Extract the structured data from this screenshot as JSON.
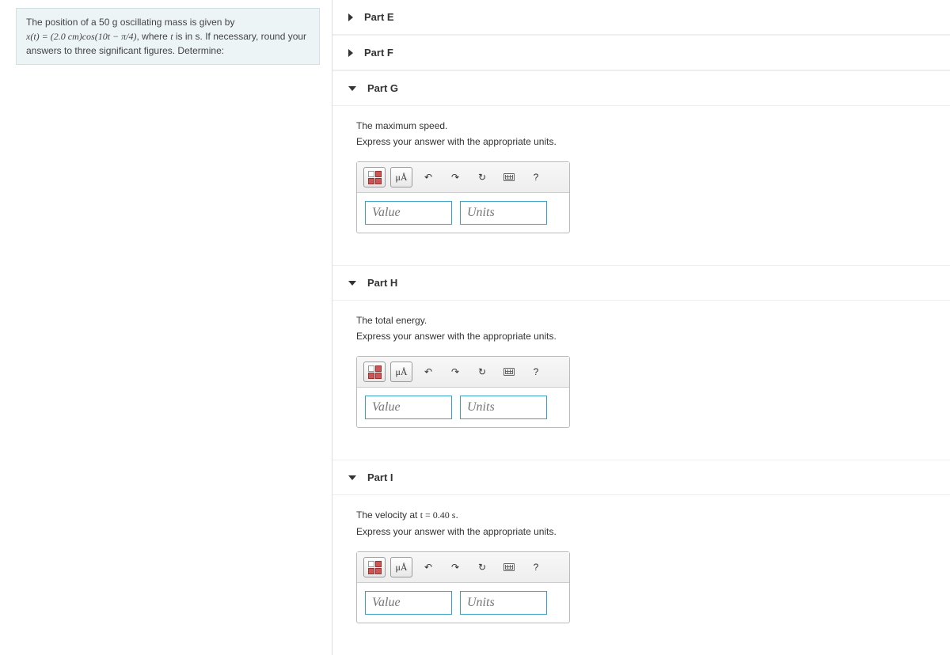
{
  "problem": {
    "line1_a": "The position of a 50 g oscillating mass is given by",
    "eq_left": "x(t) = (2.0 cm)cos(10t − π/4)",
    "line2_b": ", where ",
    "t_var": "t",
    "line2_c": " is in s. If necessary, round your answers to three significant figures. Determine:"
  },
  "parts": {
    "e": {
      "label": "Part E"
    },
    "f": {
      "label": "Part F"
    },
    "g": {
      "label": "Part G",
      "question": "The maximum speed.",
      "hint": "Express your answer with the appropriate units.",
      "value_ph": "Value",
      "units_ph": "Units"
    },
    "h": {
      "label": "Part H",
      "question": "The total energy.",
      "hint": "Express your answer with the appropriate units.",
      "value_ph": "Value",
      "units_ph": "Units"
    },
    "i": {
      "label": "Part I",
      "question_a": "The velocity at ",
      "question_eq": "t = 0.40 s",
      "question_b": ".",
      "hint": "Express your answer with the appropriate units.",
      "value_ph": "Value",
      "units_ph": "Units"
    }
  },
  "toolbar": {
    "mua": "μÅ",
    "undo": "↶",
    "redo": "↷",
    "reset": "↻",
    "help": "?"
  }
}
